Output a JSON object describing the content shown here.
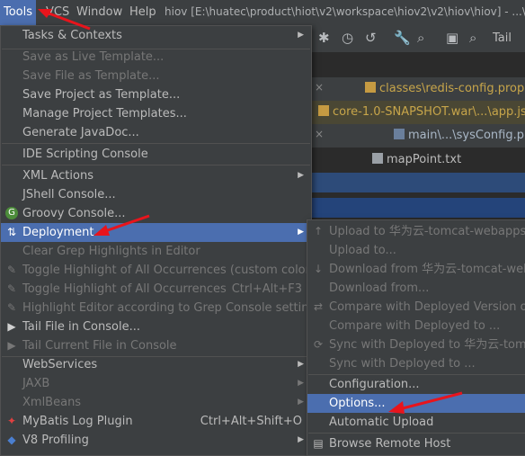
{
  "menubar": {
    "items": [
      {
        "label": "Tools"
      },
      {
        "label": "VCS"
      },
      {
        "label": "Window"
      },
      {
        "label": "Help"
      }
    ],
    "window_title": "hiov [E:\\huatec\\product\\hiot\\v2\\workspace\\hiov2\\v2\\hiov\\hiov] - ...\\"
  },
  "toolbar": {
    "tail_label": "Tail"
  },
  "editor_tabs": [
    {
      "label": "classes\\redis-config.prop"
    },
    {
      "label": "core-1.0-SNAPSHOT.war\\...\\app.js"
    },
    {
      "label": "main\\...\\sysConfig.prop"
    },
    {
      "label": "mapPoint.txt"
    }
  ],
  "tools_menu": {
    "items": [
      {
        "label": "Tasks & Contexts",
        "shortcut": "",
        "has_arrow": true,
        "disabled": false
      },
      {
        "label": "Save as Live Template...",
        "disabled": true
      },
      {
        "label": "Save File as Template...",
        "disabled": true
      },
      {
        "label": "Save Project as Template...",
        "disabled": false
      },
      {
        "label": "Manage Project Templates...",
        "disabled": false
      },
      {
        "label": "Generate JavaDoc...",
        "disabled": false
      },
      {
        "label": "IDE Scripting Console",
        "disabled": false
      },
      {
        "label": "XML Actions",
        "has_arrow": true,
        "disabled": false
      },
      {
        "label": "JShell Console...",
        "disabled": false
      },
      {
        "label": "Groovy Console...",
        "disabled": false
      },
      {
        "label": "Deployment",
        "has_arrow": true,
        "selected": true
      },
      {
        "label": "Clear Grep Highlights in Editor",
        "disabled": true
      },
      {
        "label": "Toggle Highlight of All Occurrences (custom color)",
        "disabled": true
      },
      {
        "label": "Toggle Highlight of All Occurrences",
        "shortcut": "Ctrl+Alt+F3",
        "disabled": true
      },
      {
        "label": "Highlight Editor according to Grep Console settings",
        "disabled": true
      },
      {
        "label": "Tail File in Console...",
        "disabled": false
      },
      {
        "label": "Tail Current File in Console",
        "disabled": true
      },
      {
        "label": "WebServices",
        "has_arrow": true,
        "disabled": false
      },
      {
        "label": "JAXB",
        "has_arrow": true,
        "disabled": true
      },
      {
        "label": "XmlBeans",
        "has_arrow": true,
        "disabled": true
      },
      {
        "label": "MyBatis Log Plugin",
        "shortcut": "Ctrl+Alt+Shift+O",
        "disabled": false
      },
      {
        "label": "V8 Profiling",
        "has_arrow": true,
        "disabled": false
      }
    ]
  },
  "deployment_menu": {
    "items": [
      {
        "label": "Upload to 华为云-tomcat-webapps2",
        "disabled": true
      },
      {
        "label": "Upload to...",
        "disabled": true
      },
      {
        "label": "Download from 华为云-tomcat-webap",
        "disabled": true
      },
      {
        "label": "Download from...",
        "disabled": true
      },
      {
        "label": "Compare with Deployed Version on 华",
        "disabled": true
      },
      {
        "label": "Compare with Deployed to ...",
        "disabled": true
      },
      {
        "label": "Sync with Deployed to 华为云-tomcat-",
        "disabled": true
      },
      {
        "label": "Sync with Deployed to ...",
        "disabled": true
      },
      {
        "label": "Configuration...",
        "disabled": false
      },
      {
        "label": "Options...",
        "selected": true
      },
      {
        "label": "Automatic Upload",
        "disabled": false
      },
      {
        "label": "Browse Remote Host",
        "disabled": false
      }
    ]
  },
  "colors": {
    "menu_bg": "#3c3f41",
    "selection": "#4b6eaf",
    "annotation_arrow": "#e8141c",
    "text": "#bbbbbb",
    "disabled_text": "#777777"
  }
}
